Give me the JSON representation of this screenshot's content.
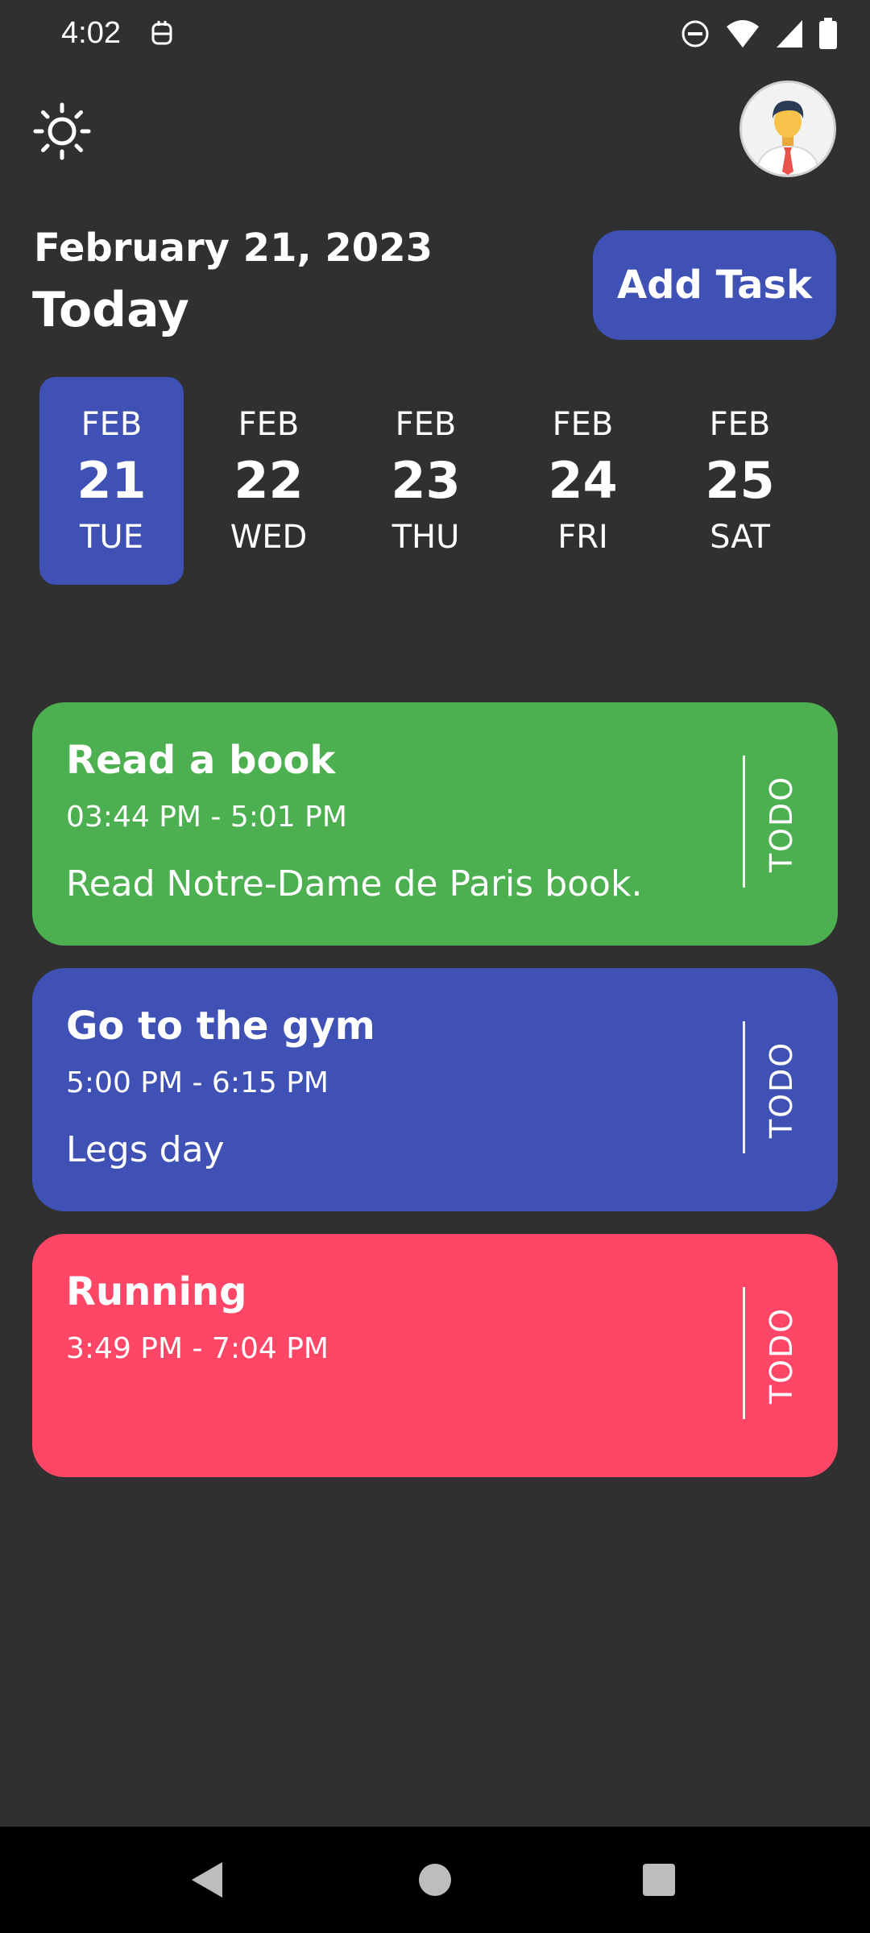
{
  "status_bar": {
    "time": "4:02",
    "icons": [
      "notification-icon",
      "do-not-disturb-icon",
      "wifi-icon",
      "signal-icon",
      "battery-icon"
    ]
  },
  "header": {
    "theme_icon": "sun-icon",
    "avatar_icon": "user-avatar"
  },
  "heading": {
    "date": "February 21, 2023",
    "today": "Today"
  },
  "add_task_button": "Add Task",
  "date_strip": [
    {
      "month": "FEB",
      "day": "21",
      "weekday": "TUE",
      "selected": true
    },
    {
      "month": "FEB",
      "day": "22",
      "weekday": "WED",
      "selected": false
    },
    {
      "month": "FEB",
      "day": "23",
      "weekday": "THU",
      "selected": false
    },
    {
      "month": "FEB",
      "day": "24",
      "weekday": "FRI",
      "selected": false
    },
    {
      "month": "FEB",
      "day": "25",
      "weekday": "SAT",
      "selected": false
    }
  ],
  "tasks": [
    {
      "title": "Read a book",
      "time": "03:44 PM - 5:01 PM",
      "note": "Read Notre-Dame de Paris book.",
      "status": "TODO",
      "color": "#4caf50"
    },
    {
      "title": "Go to the gym",
      "time": "5:00 PM - 6:15 PM",
      "note": "Legs day",
      "status": "TODO",
      "color": "#3f51b5"
    },
    {
      "title": "Running",
      "time": "3:49 PM - 7:04 PM",
      "note": "",
      "status": "TODO",
      "color": "#ff4667"
    }
  ],
  "colors": {
    "background": "#303030",
    "accent": "#3f51b5"
  },
  "nav_bar": {
    "icons": [
      "back-icon",
      "home-icon",
      "recents-icon"
    ]
  }
}
